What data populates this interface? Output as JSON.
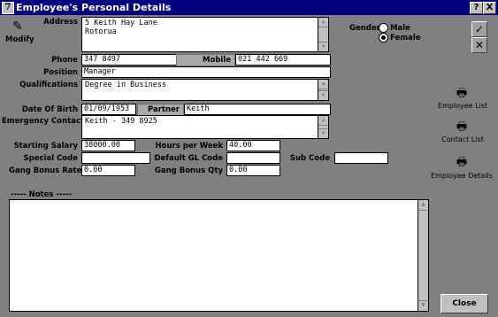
{
  "window": {
    "title": "Employee's Personal Details",
    "app_icon_glyph": "7",
    "help_button": "?",
    "close_button": "X"
  },
  "toolbar": {
    "modify_label": "Modify"
  },
  "labels": {
    "address": "Address",
    "phone": "Phone",
    "mobile": "Mobile",
    "position": "Position",
    "qualifications": "Qualifications",
    "date_of_birth": "Date Of Birth",
    "partner": "Partner",
    "emergency_contact": "Emergency Contact",
    "starting_salary": "Starting Salary",
    "special_code": "Special Code",
    "gang_bonus_rate": "Gang Bonus Rate",
    "hours_per_week": "Hours per Week",
    "default_gl_code": "Default GL Code",
    "gang_bonus_qty": "Gang Bonus Qty",
    "sub_code": "Sub Code",
    "gender": "Gender",
    "notes_header": "-----  Notes  -----"
  },
  "fields": {
    "address_line1": "5 Keith Hay Lane",
    "address_line2": "Rotorua",
    "phone": "347 8497",
    "mobile": "021 442 669",
    "position": "Manager",
    "qualifications": "Degree in Business",
    "date_of_birth": "01/09/1953",
    "partner": "Keith",
    "emergency_contact": "Keith - 349 8925",
    "starting_salary": "38000.00",
    "special_code": "",
    "gang_bonus_rate": "0.00",
    "hours_per_week": "40.00",
    "default_gl_code": "",
    "gang_bonus_qty": "0.00",
    "sub_code": "",
    "notes": ""
  },
  "gender": {
    "options": [
      "Male",
      "Female"
    ],
    "selected": "Female"
  },
  "side_actions": {
    "ok_glyph": "✓",
    "cancel_glyph": "✕",
    "employee_list": "Employee List",
    "contact_list": "Contact List",
    "employee_details": "Employee Details"
  },
  "footer": {
    "close_label": "Close"
  },
  "icons": {
    "modify": "pencil-icon",
    "print": "printer-icon"
  }
}
